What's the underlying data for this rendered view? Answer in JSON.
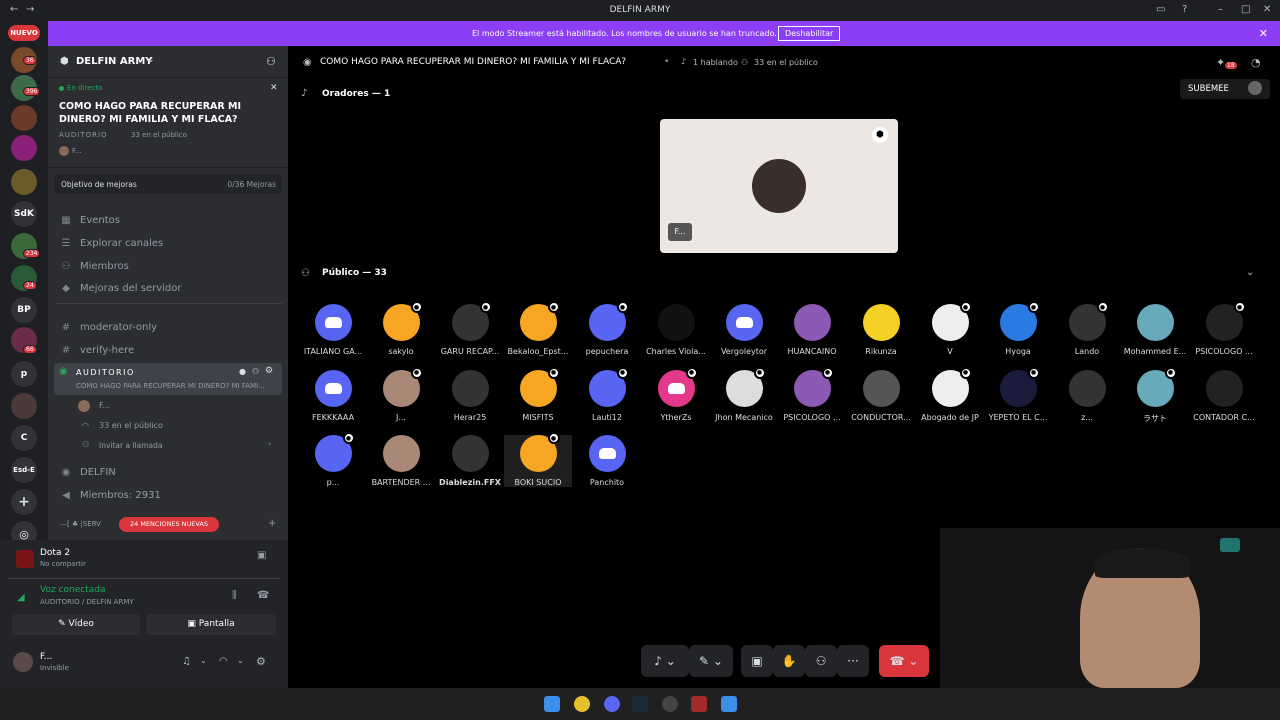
{
  "window": {
    "title": "DELFIN ARMY"
  },
  "servers": [
    {
      "label": "NUEVO",
      "badge": ""
    },
    {
      "label": "",
      "badge": "36"
    },
    {
      "label": "",
      "badge": "396"
    },
    {
      "label": "",
      "badge": ""
    },
    {
      "label": "",
      "badge": ""
    },
    {
      "label": "SdK",
      "badge": ""
    },
    {
      "label": "",
      "badge": "234"
    },
    {
      "label": "",
      "badge": "24"
    },
    {
      "label": "BP",
      "badge": ""
    },
    {
      "label": "",
      "badge": "66"
    },
    {
      "label": "p",
      "badge": ""
    },
    {
      "label": "",
      "badge": ""
    },
    {
      "label": "C",
      "badge": ""
    },
    {
      "label": "Esd-E",
      "badge": ""
    }
  ],
  "banner": {
    "message": "El modo Streamer está habilitado. Los nombres de usuario se han truncado.",
    "button": "Deshabilitar"
  },
  "sidebar": {
    "server_name": "DELFIN ARMY",
    "live": {
      "tag": "En directo",
      "title": "COMO HAGO PARA RECUPERAR MI DINERO? MI FAMILIA Y MI FLACA?",
      "channel": "AUDITORIO",
      "audience": "33 en el público",
      "user": "F..."
    },
    "boost": {
      "label": "Objetivo de mejoras",
      "value": "0/36 Mejoras"
    },
    "nav": [
      "Eventos",
      "Explorar canales",
      "Miembros",
      "Mejoras del servidor"
    ],
    "channels": [
      "moderator-only",
      "verify-here"
    ],
    "stage": {
      "name": "AUDITORIO",
      "topic": "COMO HAGO PARA RECUPERAR MI DINERO? MI FAMI...",
      "user": "F...",
      "audience": "33 en el público",
      "invite": "Invitar a llamada"
    },
    "extra": [
      "DELFIN",
      "Miembros: 2931"
    ],
    "mentions": "24 MENCIONES NUEVAS",
    "truncated_channel": "|SERV"
  },
  "activity": {
    "game": "Dota 2",
    "sub": "No compartir"
  },
  "voice": {
    "status": "Voz conectada",
    "where": "AUDITORIO / DELFIN ARMY",
    "video": "Vídeo",
    "screen": "Pantalla"
  },
  "user": {
    "name": "F...",
    "status": "Invisible"
  },
  "header": {
    "title": "COMO HAGO PARA RECUPERAR MI DINERO? MI FAMILIA Y MI FLACA?",
    "speaking": "1 hablando",
    "audience": "33 en el público",
    "notif": "18",
    "subscribe": "SUBEMEE"
  },
  "speakers": {
    "label": "Oradores — 1",
    "tile_name": "F..."
  },
  "audience_section": {
    "label": "Público — 33"
  },
  "audience": [
    "ITALIANO GA...",
    "sakylo",
    "GARU RECAP...",
    "Bekaloo_Epst...",
    "pepuchera",
    "Charles Viola...",
    "Vergoleytor",
    "HUANCAINO",
    "Rikunza",
    "V",
    "Hyoga",
    "Lando",
    "Mohammed E...",
    "PSICOLOGO ...",
    "FEKKKAAA",
    "J...",
    "Herar25",
    "MISFITS",
    "Lauti12",
    "YtherZs",
    "Jhon Mecanico",
    "PSICOLOGO ...",
    "CONDUCTOR...",
    "Abogado de JP",
    "YEPETO EL C...",
    "z...",
    "ラサト",
    "CONTADOR C...",
    "p...",
    "BARTENDER ...",
    "Diablezin.FFX",
    "BOKI SUCIO",
    "Panchito"
  ],
  "colors": {
    "accent": "#5865f2",
    "banner": "#8b3ef4",
    "danger": "#da373c",
    "online": "#23a55a"
  }
}
